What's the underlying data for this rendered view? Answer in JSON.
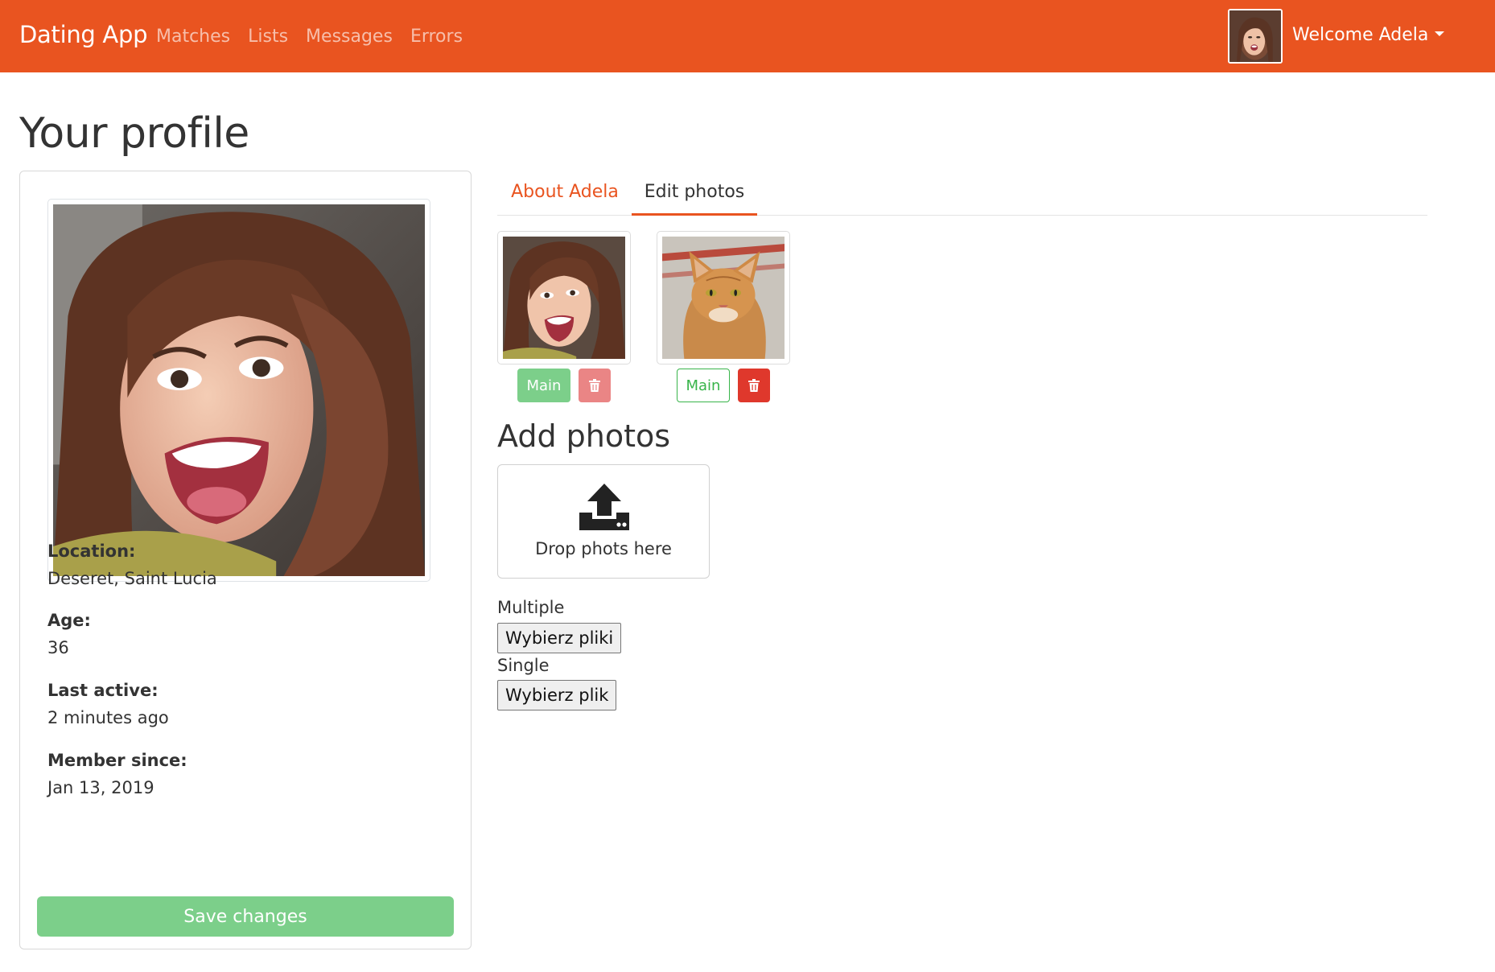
{
  "navbar": {
    "brand": "Dating App",
    "links": [
      "Matches",
      "Lists",
      "Messages",
      "Errors"
    ],
    "welcome": "Welcome Adela"
  },
  "page": {
    "title": "Your profile"
  },
  "profile": {
    "location_label": "Location:",
    "location": "Deseret, Saint Lucia",
    "age_label": "Age:",
    "age": "36",
    "last_active_label": "Last active:",
    "last_active": "2 minutes ago",
    "member_since_label": "Member since:",
    "member_since": "Jan 13, 2019",
    "save_label": "Save changes"
  },
  "tabs": {
    "about": "About Adela",
    "edit_photos": "Edit photos",
    "active": "Edit photos"
  },
  "photos": [
    {
      "subject": "woman-portrait",
      "main_label": "Main",
      "is_main": true
    },
    {
      "subject": "orange-tabby-cat",
      "main_label": "Main",
      "is_main": false
    }
  ],
  "upload": {
    "heading": "Add photos",
    "drop_text": "Drop phots here",
    "multiple_label": "Multiple",
    "multiple_button": "Wybierz pliki",
    "single_label": "Single",
    "single_button": "Wybierz plik"
  },
  "colors": {
    "brand": "#e95420",
    "success": "#38b44a",
    "success_faded": "#7ccf8a",
    "danger": "#df382c",
    "danger_faded": "#ea8585"
  },
  "icons": [
    "upload-icon",
    "trash-icon",
    "caret-down-icon"
  ]
}
